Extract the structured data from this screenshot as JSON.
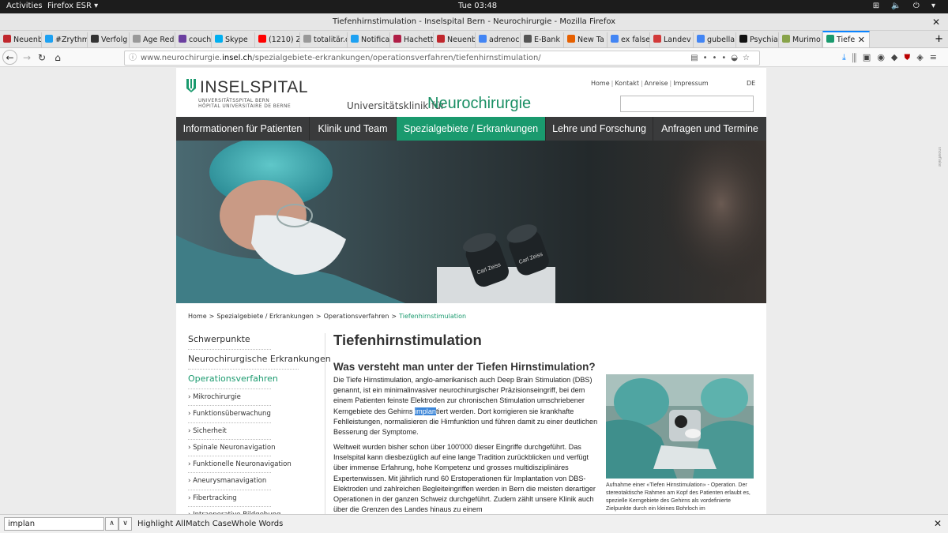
{
  "gnome": {
    "activities": "Activities",
    "app": "Firefox ESR ▾",
    "clock": "Tue 03:48",
    "tray": "⊞ 🔈 ⏻ ▾"
  },
  "window_title": "Tiefenhirnstimulation - Inselspital Bern - Neurochirurgie - Mozilla Firefox",
  "tabs": [
    {
      "label": "Neuenb",
      "color": "#c0272d"
    },
    {
      "label": "#Zrythm",
      "color": "#1da1f2"
    },
    {
      "label": "Verfolg",
      "color": "#333333"
    },
    {
      "label": "Age Reduct",
      "color": "#999999"
    },
    {
      "label": "couchsu",
      "color": "#6b3fa0"
    },
    {
      "label": "Skype",
      "color": "#00aff0"
    },
    {
      "label": "(1210) Z",
      "color": "#ff0000"
    },
    {
      "label": "totalitär.de",
      "color": "#999999"
    },
    {
      "label": "Notifica",
      "color": "#1da1f2"
    },
    {
      "label": "Hachett",
      "color": "#b01f47"
    },
    {
      "label": "Neuenb",
      "color": "#c0272d"
    },
    {
      "label": "adrenoc",
      "color": "#4285f4"
    },
    {
      "label": "E-Bank",
      "color": "#555555"
    },
    {
      "label": "New Ta",
      "color": "#e66000"
    },
    {
      "label": "ex false",
      "color": "#4285f4"
    },
    {
      "label": "Landev",
      "color": "#d23a3a"
    },
    {
      "label": "gubella",
      "color": "#4285f4"
    },
    {
      "label": "Psychia",
      "color": "#111111"
    },
    {
      "label": "Murimo",
      "color": "#88a34a"
    },
    {
      "label": "Tiefe",
      "color": "#1a9a6e"
    }
  ],
  "url": {
    "prefix": "www.neurochirurgie.",
    "host": "insel.ch",
    "path": "/spezialgebiete-erkrankungen/operationsverfahren/tiefenhirnstimulation/"
  },
  "header": {
    "logo": "INSELSPITAL",
    "logo_sub1": "UNIVERSITÄTSSPITAL BERN",
    "logo_sub2": "HÔPITAL UNIVERSITAIRE DE BERNE",
    "clinic_pre": "Universitätsklinik für",
    "clinic_name": "Neurochirurgie",
    "meta_links": [
      "Home",
      "Kontakt",
      "Anreise",
      "Impressum"
    ],
    "lang": "DE"
  },
  "mainnav": [
    "Informationen für Patienten",
    "Klinik und Team",
    "Spezialgebiete / Erkrankungen",
    "Lehre und Forschung",
    "Anfragen und Termine"
  ],
  "breadcrumb": [
    "Home",
    "Spezialgebiete / Erkrankungen",
    "Operationsverfahren",
    "Tiefenhirnstimulation"
  ],
  "sidebar": {
    "top": [
      "Schwerpunkte",
      "Neurochirurgische Erkrankungen",
      "Operationsverfahren"
    ],
    "sub": [
      "Mikrochirurgie",
      "Funktionsüberwachung",
      "Sicherheit",
      "Spinale Neuronavigation",
      "Funktionelle Neuronavigation",
      "Aneurysmanavigation",
      "Fibertracking",
      "Intraoperative Bildgebung"
    ]
  },
  "content": {
    "title": "Tiefenhirnstimulation",
    "section_title": "Was versteht man unter der Tiefen Hirnstimulation?",
    "para1_a": "Die Tiefe Hirnstimulation, anglo-amerikanisch auch Deep Brain Stimulation (DBS) genannt, ist ein minimalinvasiver neurochirurgischer Präzisionseingriff, bei dem einem Patienten feinste Elektroden zur chronischen Stimulation umschriebener Kerngebiete des Gehirns ",
    "para1_hl": "implan",
    "para1_b": "tiert werden. Dort korrigieren sie krankhafte Fehlleistungen, normalisieren die Hirnfunktion und führen damit zu einer deutlichen Besserung der Symptome.",
    "para2": "Weltweit wurden bisher schon über 100'000 dieser Eingriffe durchgeführt. Das Inselspital kann diesbezüglich auf eine lange Tradition zurückblicken und verfügt über immense Erfahrung, hohe Kompetenz und grosses multidisziplinäres Expertenwissen. Mit jährlich rund 60 Erstoperationen für Implantation von DBS-Elektroden und zahlreichen Begleiteingriffen werden in Bern die meisten derartiger Operationen in der ganzen Schweiz durchgeführt. Zudem zählt unsere Klinik auch über die Grenzen des Landes hinaus zu einem",
    "caption": "Aufnahme einer «Tiefen Hirnstimulation» - Operation. Der stereotaktische Rahmen am Kopf des Patienten erlaubt es, spezielle Kerngebiete des Gehirns als vordefinierte Zielpunkte durch ein kleines Bohrloch im"
  },
  "hero_brand": [
    "Carl Zeiss",
    "Carl Zeiss"
  ],
  "findbar": {
    "query": "implan",
    "highlight_all": "Highlight All",
    "match_case": "Match Case",
    "whole_words": "Whole Words"
  },
  "colors": {
    "accent": "#1a9a6e",
    "nav_bg": "#3a3b3c",
    "selection": "#3b85d8"
  }
}
